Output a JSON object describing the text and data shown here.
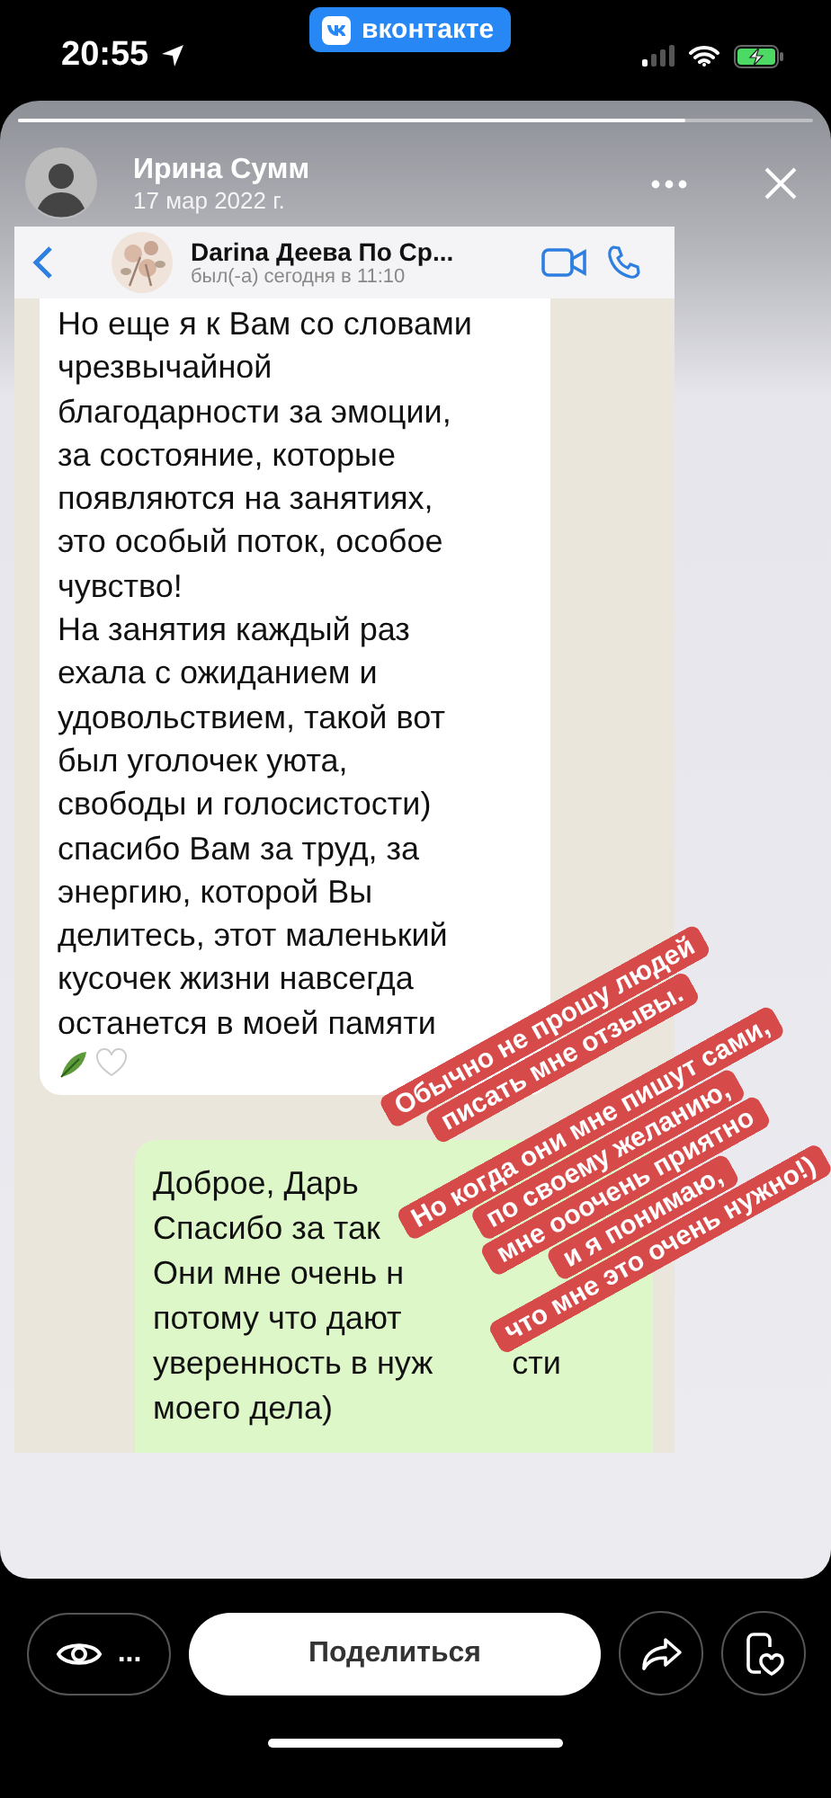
{
  "status_bar": {
    "time": "20:55",
    "app_badge": "вконтакте"
  },
  "story": {
    "progress": {
      "level": 0.84
    },
    "author": {
      "name": "Ирина Сумм",
      "date": "17 мар 2022 г."
    },
    "screenshot": {
      "contact": "Darina Деева По Ср...",
      "status": "был(-а) сегодня в 11:10",
      "incoming": "Но еще я к Вам со словами\nчрезвычайной\nблагодарности за эмоции,\nза состояние, которые\nпоявляются на занятиях,\nэто особый поток, особое\nчувство!\nНа занятия каждый раз\nехала с ожиданием и\nудовольствием, такой вот\nбыл уголочек уюта,\nсвободы и голосистости)\nспасибо Вам за труд, за\nэнергию, которой Вы\nделитесь, этот маленький\nкусочек жизни навсегда\nостанется в моей памяти",
      "outgoing": [
        {
          "text": "Доброе, Дарь"
        },
        {
          "text": "Спасибо за так"
        },
        {
          "text": "Они мне очень н"
        },
        {
          "text": "потому что дают"
        },
        {
          "text": "уверенность в нуж",
          "tail": "сти"
        },
        {
          "text": "моего дела)"
        }
      ]
    },
    "stickers": [
      {
        "text": "Обычно не прошу людей\nписать мне отзывы."
      },
      {
        "text": "Но когда они мне пишут сами,\nпо своему желанию,\nмне ооочень приятно\nи я понимаю,\nчто мне это очень нужно!)"
      }
    ]
  },
  "actions": {
    "views": "...",
    "share": "Поделиться"
  }
}
